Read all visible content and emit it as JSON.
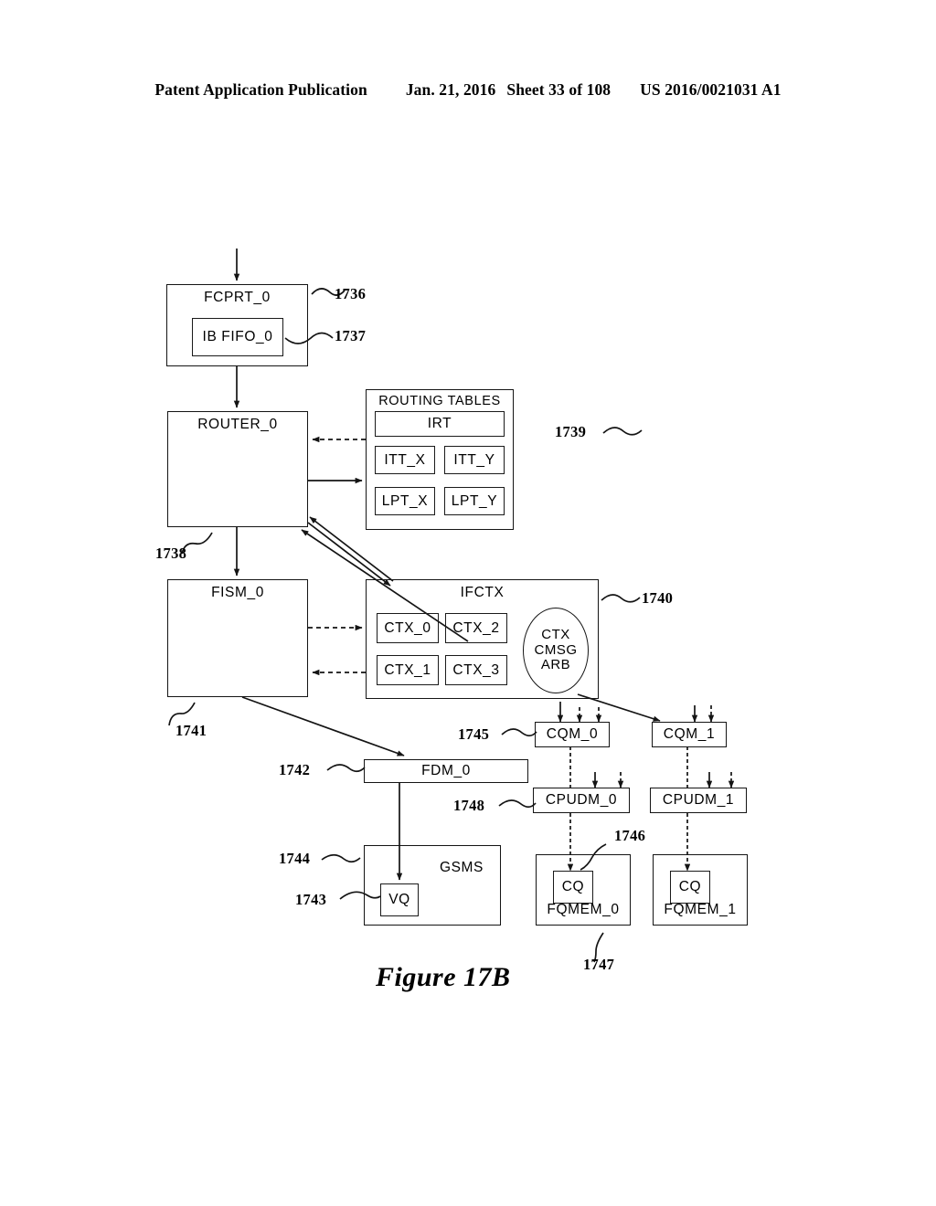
{
  "header": {
    "publication": "Patent Application Publication",
    "date": "Jan. 21, 2016",
    "sheet": "Sheet 33 of 108",
    "patent_number": "US 2016/0021031 A1"
  },
  "figure": {
    "caption": "Figure 17B"
  },
  "blocks": {
    "fcprt0": "FCPRT_0",
    "ib_fifo0": "IB FIFO_0",
    "router0": "ROUTER_0",
    "routing_tables": "ROUTING TABLES",
    "irt": "IRT",
    "itt_x": "ITT_X",
    "itt_y": "ITT_Y",
    "lpt_x": "LPT_X",
    "lpt_y": "LPT_Y",
    "fism0": "FISM_0",
    "ifctx": "IFCTX",
    "ctx0": "CTX_0",
    "ctx1": "CTX_1",
    "ctx2": "CTX_2",
    "ctx3": "CTX_3",
    "ctx_cmsg_arb_l1": "CTX",
    "ctx_cmsg_arb_l2": "CMSG",
    "ctx_cmsg_arb_l3": "ARB",
    "cqm0": "CQM_0",
    "cqm1": "CQM_1",
    "cpudm0": "CPUDM_0",
    "cpudm1": "CPUDM_1",
    "fqmem0": "FQMEM_0",
    "fqmem1": "FQMEM_1",
    "cq0": "CQ",
    "cq1": "CQ",
    "fdm0": "FDM_0",
    "gsms": "GSMS",
    "vq": "VQ"
  },
  "refs": {
    "r1736": "1736",
    "r1737": "1737",
    "r1738": "1738",
    "r1739": "1739",
    "r1740": "1740",
    "r1741": "1741",
    "r1742": "1742",
    "r1743": "1743",
    "r1744": "1744",
    "r1745": "1745",
    "r1746": "1746",
    "r1747": "1747",
    "r1748": "1748"
  }
}
